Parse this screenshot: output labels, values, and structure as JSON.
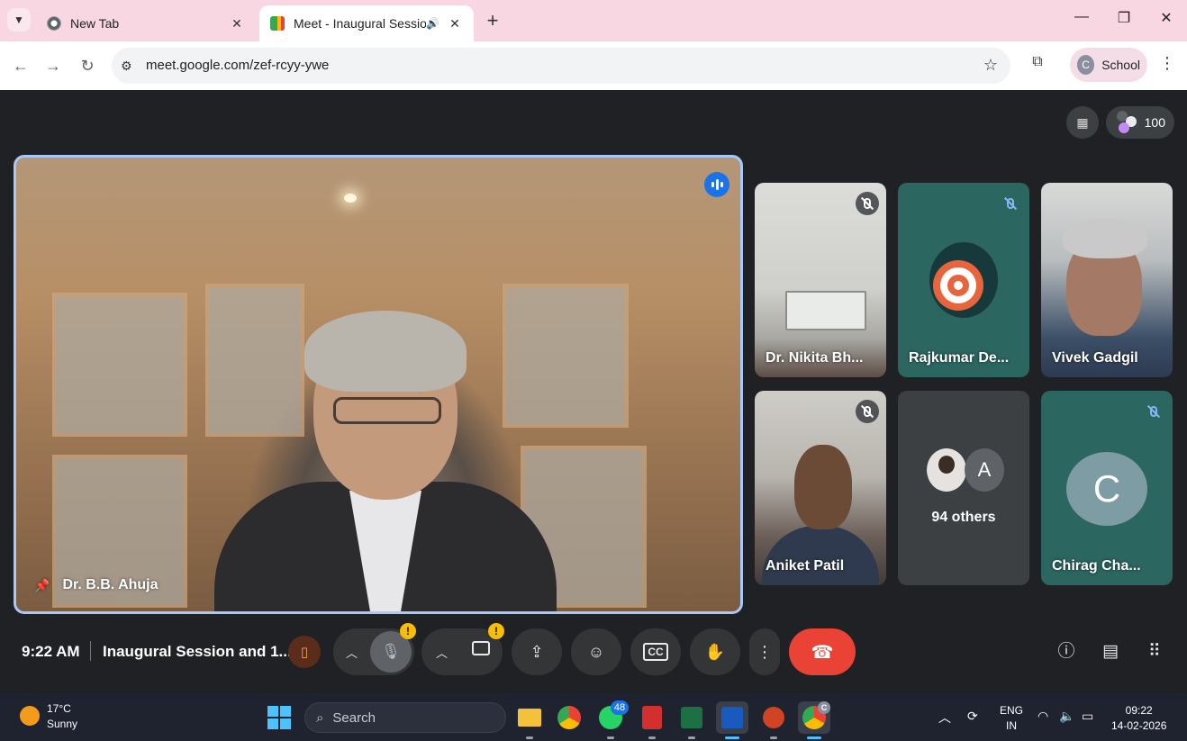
{
  "browser": {
    "tabs": [
      {
        "label": "New Tab",
        "active": false
      },
      {
        "label": "Meet - Inaugural Session an",
        "active": true
      }
    ],
    "address": "meet.google.com/zef-rcyy-ywe",
    "profile": {
      "initial": "C",
      "label": "School"
    }
  },
  "meet": {
    "participant_count": "100",
    "main_speaker": "Dr. B.B. Ahuja",
    "tiles": [
      {
        "name": "Dr. Nikita Bh...",
        "muted": true
      },
      {
        "name": "Rajkumar De...",
        "muted": true
      },
      {
        "name": "Vivek Gadgil",
        "muted": false
      },
      {
        "name": "Aniket Patil",
        "muted": true
      },
      {
        "name": "94 others",
        "avatar_letter": "A"
      },
      {
        "name": "Chirag Cha...",
        "avatar_letter": "C",
        "muted": true
      }
    ],
    "time": "9:22 AM",
    "meeting_title": "Inaugural Session and 1...",
    "warning_symbol": "!"
  },
  "taskbar": {
    "weather_temp": "17°C",
    "weather_desc": "Sunny",
    "search_placeholder": "Search",
    "whatsapp_badge": "48",
    "chrome_badge": "C",
    "lang_line1": "ENG",
    "lang_line2": "IN",
    "clock_time": "09:22",
    "clock_date": "14-02-2026"
  },
  "colors": {
    "tabbar_bg": "#f8d7e3",
    "meet_bg": "#202124",
    "active_speaker_border": "#a8c7fa",
    "end_call": "#ea4335",
    "taskbar_bg": "#1f2330",
    "tile_teal": "#2c6660"
  }
}
